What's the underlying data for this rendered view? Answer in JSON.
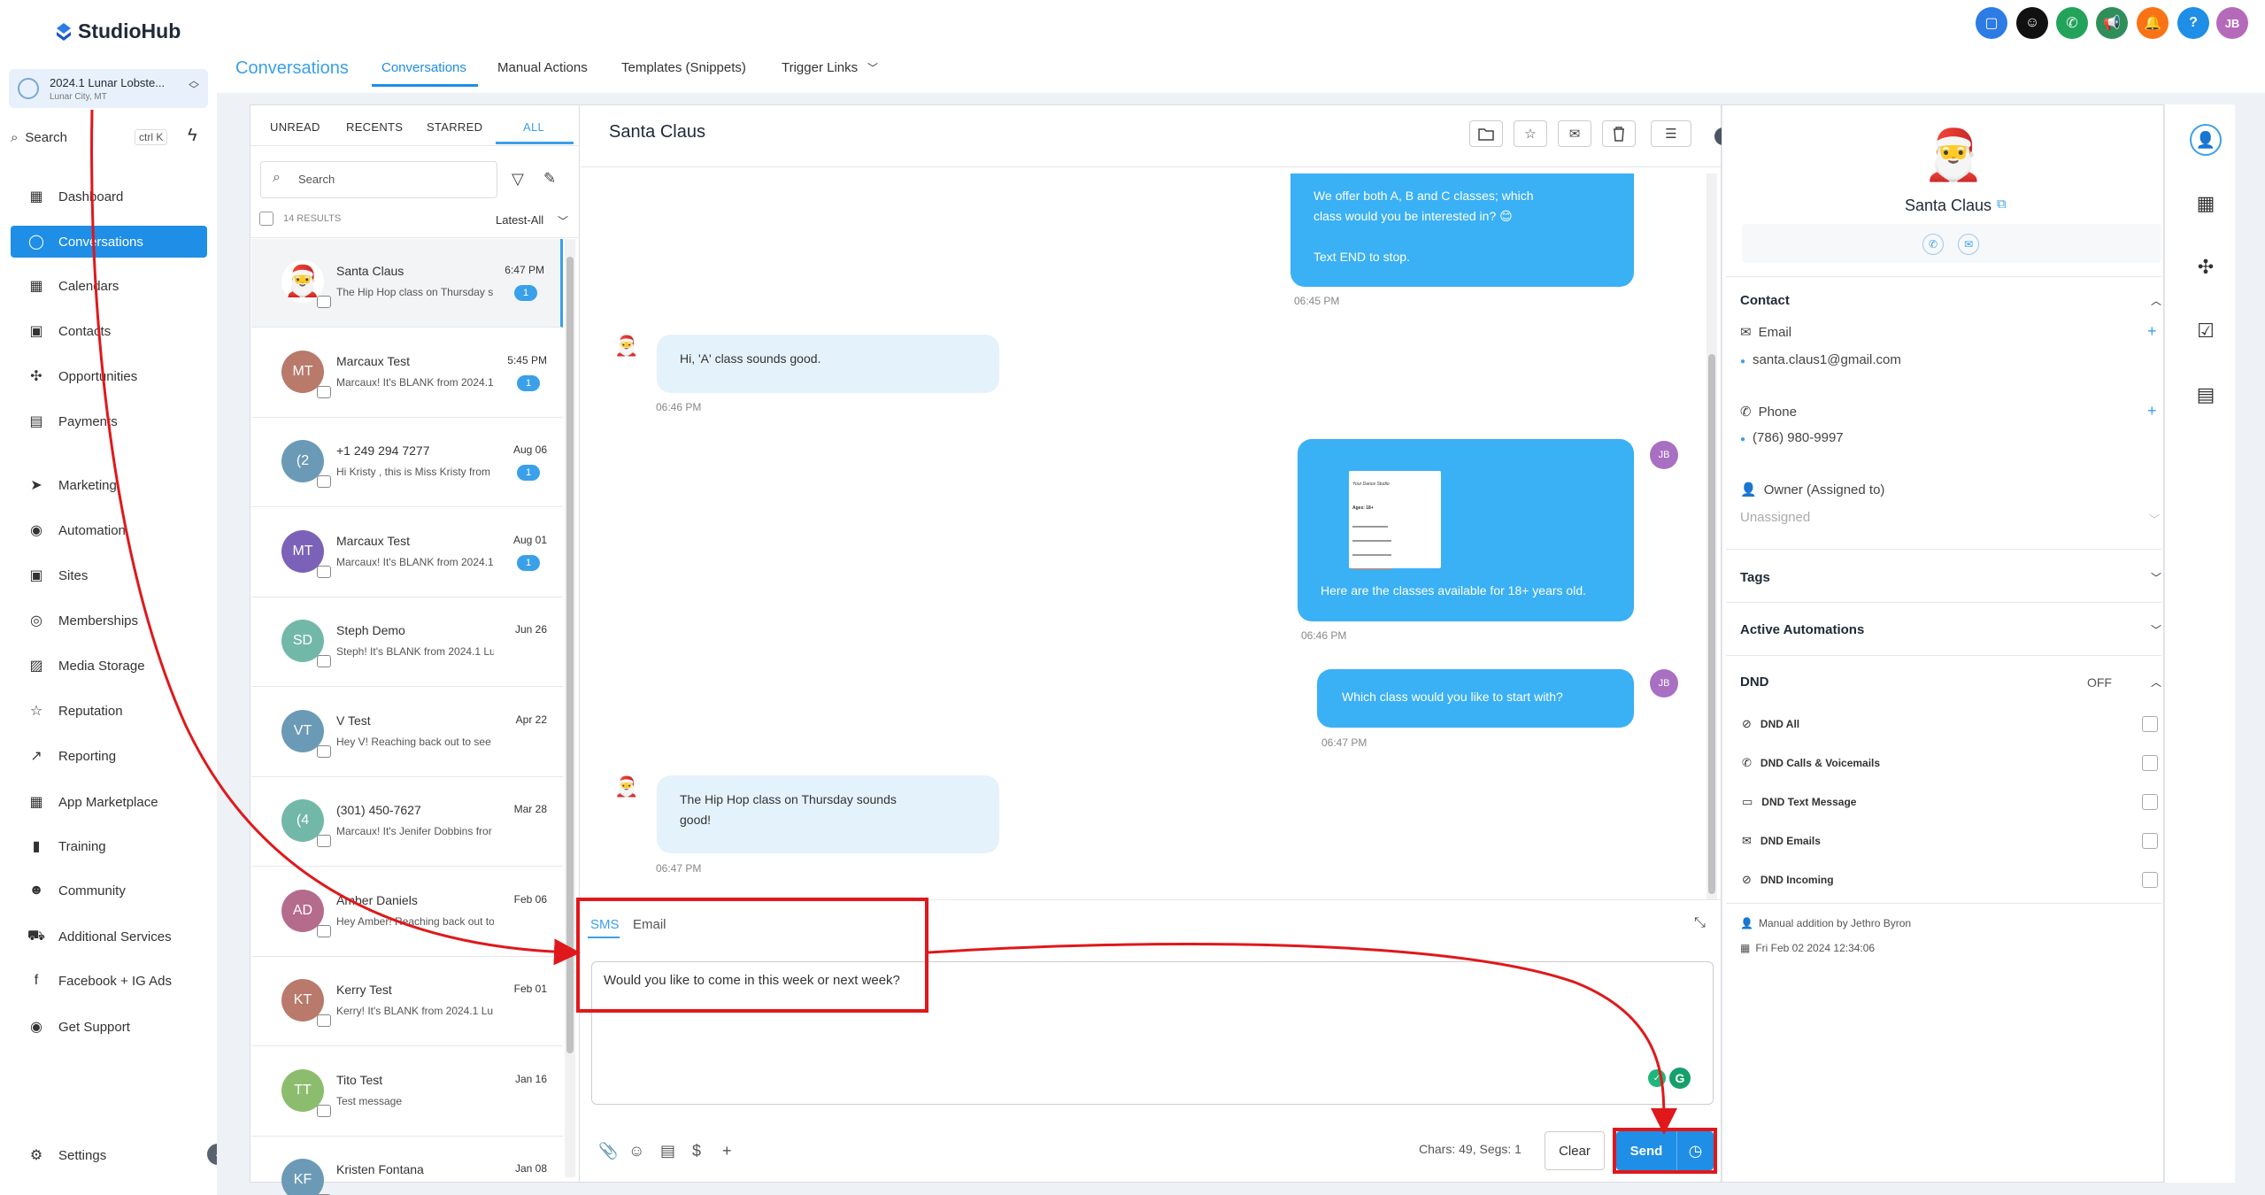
{
  "app": {
    "logo": "StudioHub",
    "location_name": "2024.1 Lunar Lobste...",
    "location_sub": "Lunar City, MT",
    "search_label": "Search",
    "search_shortcut": "ctrl K"
  },
  "sidebar": {
    "items": [
      {
        "label": "Dashboard",
        "icon": "dashboard-icon"
      },
      {
        "label": "Conversations",
        "icon": "chat-icon"
      },
      {
        "label": "Calendars",
        "icon": "calendar-icon"
      },
      {
        "label": "Contacts",
        "icon": "contacts-icon"
      },
      {
        "label": "Opportunities",
        "icon": "opportunities-icon"
      },
      {
        "label": "Payments",
        "icon": "payments-icon"
      },
      {
        "label": "Marketing",
        "icon": "send-icon"
      },
      {
        "label": "Automation",
        "icon": "automation-icon"
      },
      {
        "label": "Sites",
        "icon": "sites-icon"
      },
      {
        "label": "Memberships",
        "icon": "memberships-icon"
      },
      {
        "label": "Media Storage",
        "icon": "media-icon"
      },
      {
        "label": "Reputation",
        "icon": "star-icon"
      },
      {
        "label": "Reporting",
        "icon": "reporting-icon"
      },
      {
        "label": "App Marketplace",
        "icon": "marketplace-icon"
      },
      {
        "label": "Training",
        "icon": "book-icon"
      },
      {
        "label": "Community",
        "icon": "community-icon"
      },
      {
        "label": "Additional Services",
        "icon": "cart-icon"
      },
      {
        "label": "Facebook + IG Ads",
        "icon": "facebook-icon"
      },
      {
        "label": "Get Support",
        "icon": "support-icon"
      }
    ],
    "settings_label": "Settings"
  },
  "header": {
    "section_title": "Conversations",
    "tabs": [
      {
        "label": "Conversations"
      },
      {
        "label": "Manual Actions"
      },
      {
        "label": "Templates (Snippets)"
      },
      {
        "label": "Trigger Links"
      }
    ],
    "user_initials": "JB",
    "colors": {
      "accent": "#1e8ee6",
      "annotation": "#e0181b"
    }
  },
  "list": {
    "filters": [
      {
        "label": "UNREAD"
      },
      {
        "label": "RECENTS"
      },
      {
        "label": "STARRED"
      },
      {
        "label": "ALL"
      }
    ],
    "search_placeholder": "Search",
    "results": "14 RESULTS",
    "sort": "Latest-All",
    "conversations": [
      {
        "initials": "",
        "name": "Santa Claus",
        "time": "6:47 PM",
        "snippet": "The Hip Hop class on Thursday s",
        "badge": "1",
        "color": "#ffffff"
      },
      {
        "initials": "MT",
        "name": "Marcaux Test",
        "time": "5:45 PM",
        "snippet": "Marcaux! It's BLANK from 2024.1",
        "badge": "1",
        "color": "#b97a6b"
      },
      {
        "initials": "(2",
        "name": "+1 249 294 7277",
        "time": "Aug 06",
        "snippet": "Hi Kristy , this is Miss Kristy from",
        "badge": "1",
        "color": "#6b9ab6"
      },
      {
        "initials": "MT",
        "name": "Marcaux Test",
        "time": "Aug 01",
        "snippet": "Marcaux! It's BLANK from 2024.1",
        "badge": "1",
        "color": "#7b62b8"
      },
      {
        "initials": "SD",
        "name": "Steph Demo",
        "time": "Jun 26",
        "snippet": "Steph! It's BLANK from 2024.1 Lu",
        "badge": "",
        "color": "#72b8a8"
      },
      {
        "initials": "VT",
        "name": "V Test",
        "time": "Apr 22",
        "snippet": "Hey V! Reaching back out to see i",
        "badge": "",
        "color": "#6b9ab6"
      },
      {
        "initials": "(4",
        "name": "(301) 450-7627",
        "time": "Mar 28",
        "snippet": "Marcaux! It's Jenifer Dobbins fror",
        "badge": "",
        "color": "#72b8a8"
      },
      {
        "initials": "AD",
        "name": "Amber Daniels",
        "time": "Feb 06",
        "snippet": "Hey Amber! Reaching back out to",
        "badge": "",
        "color": "#b56c8c"
      },
      {
        "initials": "KT",
        "name": "Kerry Test",
        "time": "Feb 01",
        "snippet": "Kerry! It's BLANK from 2024.1 Lu",
        "badge": "",
        "color": "#b97a6b"
      },
      {
        "initials": "TT",
        "name": "Tito Test",
        "time": "Jan 16",
        "snippet": "Test message",
        "badge": "",
        "color": "#8cbd6e"
      },
      {
        "initials": "KF",
        "name": "Kristen Fontana",
        "time": "Jan 08",
        "snippet": "",
        "badge": "",
        "color": "#6b9ab6"
      }
    ]
  },
  "chat": {
    "title": "Santa Claus",
    "messages": [
      {
        "dir": "out",
        "lines": [
          "We offer both A, B and C classes; which",
          "class would you be interested in? 😊",
          "",
          "Text END to stop."
        ],
        "time": "06:45 PM"
      },
      {
        "dir": "in",
        "lines": [
          "Hi, 'A' class sounds good."
        ],
        "time": "06:46 PM"
      },
      {
        "dir": "out",
        "lines": [
          "Here are the classes available for 18+ years old."
        ],
        "time": "06:46 PM"
      },
      {
        "dir": "out",
        "lines": [
          "Which class would you like to start with?"
        ],
        "time": "06:47 PM"
      },
      {
        "dir": "in",
        "lines": [
          "The Hip Hop class on Thursday sounds",
          "good!"
        ],
        "time": "06:47 PM"
      }
    ],
    "agent_initials": "JB",
    "flyer": {
      "title": "Your Dance Studio",
      "ages": "Ages: 18+"
    }
  },
  "composer": {
    "tabs": [
      {
        "label": "SMS"
      },
      {
        "label": "Email"
      }
    ],
    "text": "Would you like to come in this week or next week?",
    "chars": "Chars: 49, Segs: 1",
    "clear_label": "Clear",
    "send_label": "Send"
  },
  "contact": {
    "name": "Santa Claus",
    "sections": {
      "contact": "Contact",
      "email_label": "Email",
      "email": "santa.claus1@gmail.com",
      "phone_label": "Phone",
      "phone": "(786) 980-9997",
      "owner_label": "Owner (Assigned to)",
      "owner_value": "Unassigned",
      "tags": "Tags",
      "automations": "Active Automations",
      "dnd": "DND",
      "dnd_state": "OFF"
    },
    "dnd_items": [
      {
        "label": "DND All"
      },
      {
        "label": "DND Calls & Voicemails"
      },
      {
        "label": "DND Text Message"
      },
      {
        "label": "DND Emails"
      },
      {
        "label": "DND Incoming"
      }
    ],
    "manual_addition": "Manual addition by Jethro Byron",
    "created": "Fri Feb 02 2024 12:34:06"
  }
}
